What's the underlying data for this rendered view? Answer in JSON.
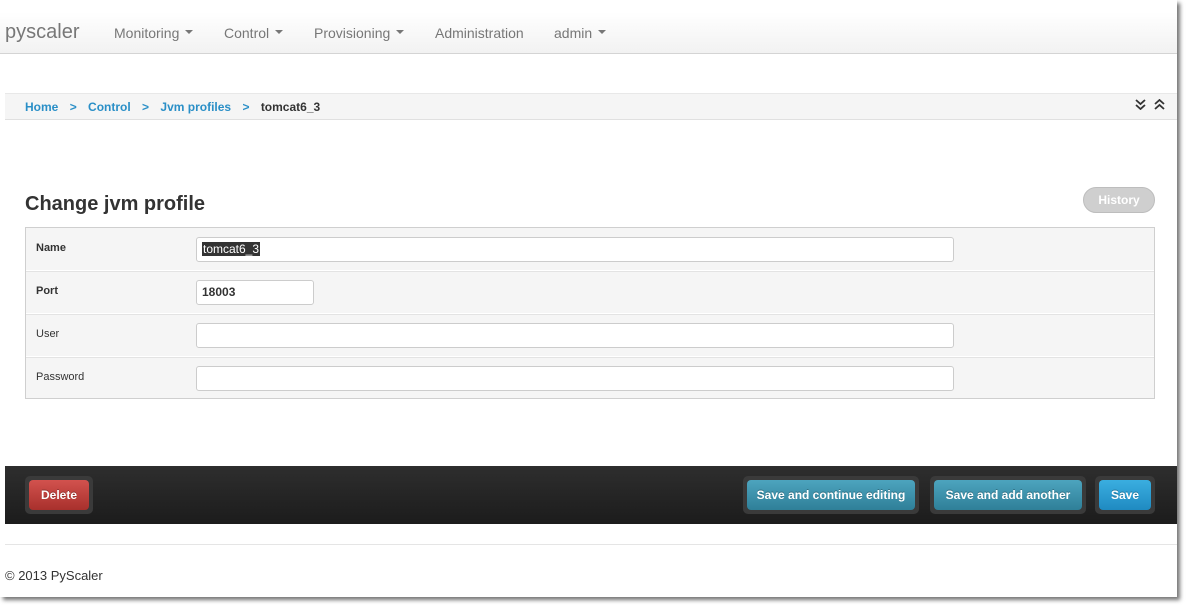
{
  "navbar": {
    "brand": "pyscaler",
    "items": [
      {
        "label": "Monitoring",
        "dropdown": true
      },
      {
        "label": "Control",
        "dropdown": true
      },
      {
        "label": "Provisioning",
        "dropdown": true
      },
      {
        "label": "Administration",
        "dropdown": false
      },
      {
        "label": "admin",
        "dropdown": true
      }
    ]
  },
  "breadcrumb": {
    "items": [
      "Home",
      "Control",
      "Jvm profiles"
    ],
    "separator": ">",
    "active": "tomcat6_3",
    "tools": {
      "collapse_icon": "double-chevron-down-icon",
      "expand_icon": "double-chevron-up-icon"
    }
  },
  "page": {
    "title": "Change jvm profile",
    "history_label": "History"
  },
  "form": {
    "fields": [
      {
        "label": "Name",
        "value": "tomcat6_3",
        "required": true
      },
      {
        "label": "Port",
        "value": "18003",
        "required": true
      },
      {
        "label": "User",
        "value": "",
        "required": false
      },
      {
        "label": "Password",
        "value": "",
        "required": false
      }
    ]
  },
  "actions": {
    "delete_label": "Delete",
    "save_continue_label": "Save and continue editing",
    "save_add_label": "Save and add another",
    "save_label": "Save"
  },
  "footer": {
    "text": "© 2013 PyScaler"
  },
  "colors": {
    "link": "#2a8fc7",
    "danger": "#b73a36",
    "info": "#3b8fa9",
    "primary": "#2a9bd3",
    "bar": "#262626"
  }
}
